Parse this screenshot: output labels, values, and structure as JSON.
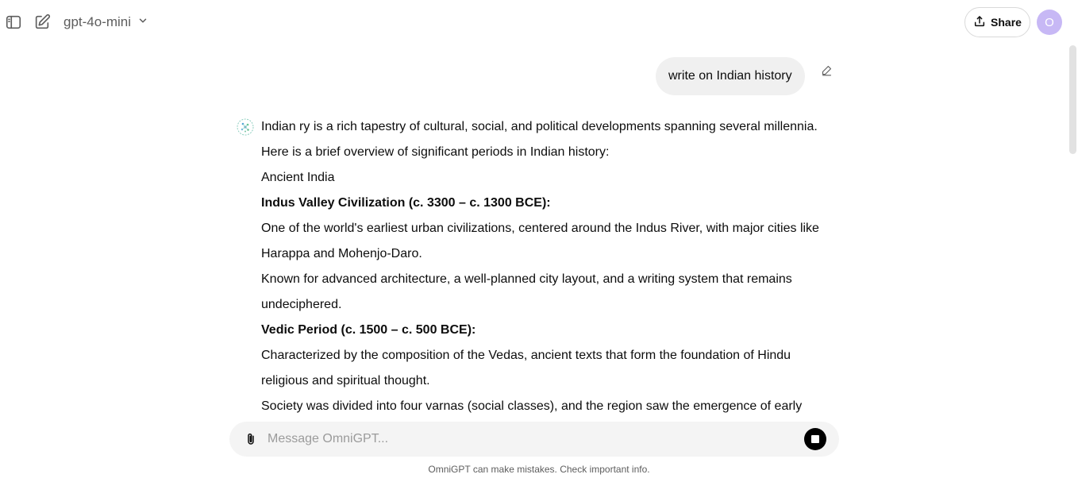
{
  "header": {
    "model_name": "gpt-4o-mini",
    "share_label": "Share",
    "avatar_initial": "O"
  },
  "icons": {
    "sidebar_toggle": "sidebar-toggle-icon",
    "new_chat": "new-chat-icon",
    "chevron": "chevron-down-icon",
    "share": "share-icon",
    "edit": "edit-pencil-icon",
    "assistant_logo": "assistant-logo-icon",
    "attach": "paperclip-icon",
    "stop": "stop-icon"
  },
  "conversation": {
    "user_message": "write on Indian history",
    "assistant_lines": [
      {
        "text": "Indian ry is a rich tapestry of cultural, social, and political developments spanning several millennia. Here is a brief overview of significant periods in Indian history:",
        "bold": false
      },
      {
        "text": "Ancient India",
        "bold": false
      },
      {
        "text": "Indus Valley Civilization (c. 3300 – c. 1300 BCE):",
        "bold": true
      },
      {
        "text": "One of the world's earliest urban civilizations, centered around the Indus River, with major cities like Harappa and Mohenjo-Daro.",
        "bold": false
      },
      {
        "text": "Known for advanced architecture, a well-planned city layout, and a writing system that remains undeciphered.",
        "bold": false
      },
      {
        "text": "Vedic Period (c. 1500 – c. 500 BCE):",
        "bold": true
      },
      {
        "text": "Characterized by the composition of the Vedas, ancient texts that form the foundation of Hindu religious and spiritual thought.",
        "bold": false
      },
      {
        "text": "Society was divided into four varnas (social classes), and the region saw the emergence of early",
        "bold": false
      }
    ]
  },
  "composer": {
    "placeholder": "Message OmniGPT..."
  },
  "footer": {
    "disclaimer": "OmniGPT can make mistakes. Check important info."
  },
  "colors": {
    "user_bubble": "#f0f0f0",
    "composer_bg": "#f4f4f4",
    "avatar_bg": "#c7b8f5",
    "muted_text": "#5d5d5d"
  }
}
